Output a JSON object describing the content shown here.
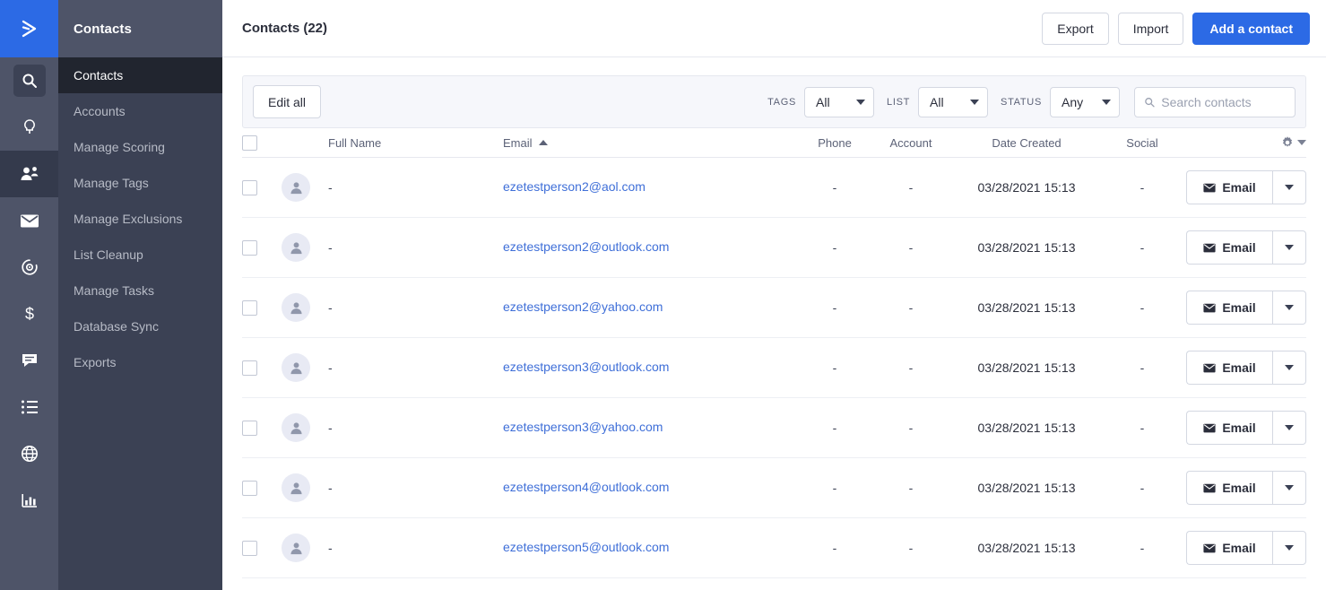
{
  "brand": {
    "logo_icon": "activecampaign-chevron-logo",
    "accent_color": "#2c6ae5"
  },
  "rail": {
    "items": [
      {
        "icon": "search-icon",
        "name": "search",
        "active": false,
        "boxed": true
      },
      {
        "icon": "lightbulb-icon",
        "name": "insights",
        "active": false,
        "boxed": false
      },
      {
        "icon": "contacts-icon",
        "name": "contacts",
        "active": true,
        "boxed": false
      },
      {
        "icon": "envelope-icon",
        "name": "campaigns",
        "active": false,
        "boxed": false
      },
      {
        "icon": "automation-icon",
        "name": "automations",
        "active": false,
        "boxed": false
      },
      {
        "icon": "dollar-icon",
        "name": "deals",
        "active": false,
        "boxed": false
      },
      {
        "icon": "chat-icon",
        "name": "conversations",
        "active": false,
        "boxed": false
      },
      {
        "icon": "list-icon",
        "name": "lists",
        "active": false,
        "boxed": false
      },
      {
        "icon": "globe-icon",
        "name": "website",
        "active": false,
        "boxed": false
      },
      {
        "icon": "chart-icon",
        "name": "reports",
        "active": false,
        "boxed": false
      }
    ]
  },
  "sidebar": {
    "header": "Contacts",
    "items": [
      {
        "label": "Contacts",
        "active": true
      },
      {
        "label": "Accounts",
        "active": false
      },
      {
        "label": "Manage Scoring",
        "active": false
      },
      {
        "label": "Manage Tags",
        "active": false
      },
      {
        "label": "Manage Exclusions",
        "active": false
      },
      {
        "label": "List Cleanup",
        "active": false
      },
      {
        "label": "Manage Tasks",
        "active": false
      },
      {
        "label": "Database Sync",
        "active": false
      },
      {
        "label": "Exports",
        "active": false
      }
    ]
  },
  "topbar": {
    "title": "Contacts (22)",
    "export_label": "Export",
    "import_label": "Import",
    "add_contact_label": "Add a contact"
  },
  "toolbar": {
    "edit_all_label": "Edit all",
    "filters": [
      {
        "label": "TAGS",
        "value": "All"
      },
      {
        "label": "LIST",
        "value": "All"
      },
      {
        "label": "STATUS",
        "value": "Any"
      }
    ],
    "search_placeholder": "Search contacts",
    "search_value": ""
  },
  "table": {
    "columns": {
      "full_name": "Full Name",
      "email": "Email",
      "phone": "Phone",
      "account": "Account",
      "date_created": "Date Created",
      "social": "Social"
    },
    "sort": {
      "column": "Email",
      "direction": "asc"
    },
    "settings_icon": "gear-icon",
    "action_label": "Email",
    "rows": [
      {
        "full_name": "-",
        "email": "ezetestperson2@aol.com",
        "phone": "-",
        "account": "-",
        "date_created": "03/28/2021 15:13",
        "social": "-"
      },
      {
        "full_name": "-",
        "email": "ezetestperson2@outlook.com",
        "phone": "-",
        "account": "-",
        "date_created": "03/28/2021 15:13",
        "social": "-"
      },
      {
        "full_name": "-",
        "email": "ezetestperson2@yahoo.com",
        "phone": "-",
        "account": "-",
        "date_created": "03/28/2021 15:13",
        "social": "-"
      },
      {
        "full_name": "-",
        "email": "ezetestperson3@outlook.com",
        "phone": "-",
        "account": "-",
        "date_created": "03/28/2021 15:13",
        "social": "-"
      },
      {
        "full_name": "-",
        "email": "ezetestperson3@yahoo.com",
        "phone": "-",
        "account": "-",
        "date_created": "03/28/2021 15:13",
        "social": "-"
      },
      {
        "full_name": "-",
        "email": "ezetestperson4@outlook.com",
        "phone": "-",
        "account": "-",
        "date_created": "03/28/2021 15:13",
        "social": "-"
      },
      {
        "full_name": "-",
        "email": "ezetestperson5@outlook.com",
        "phone": "-",
        "account": "-",
        "date_created": "03/28/2021 15:13",
        "social": "-"
      }
    ]
  }
}
